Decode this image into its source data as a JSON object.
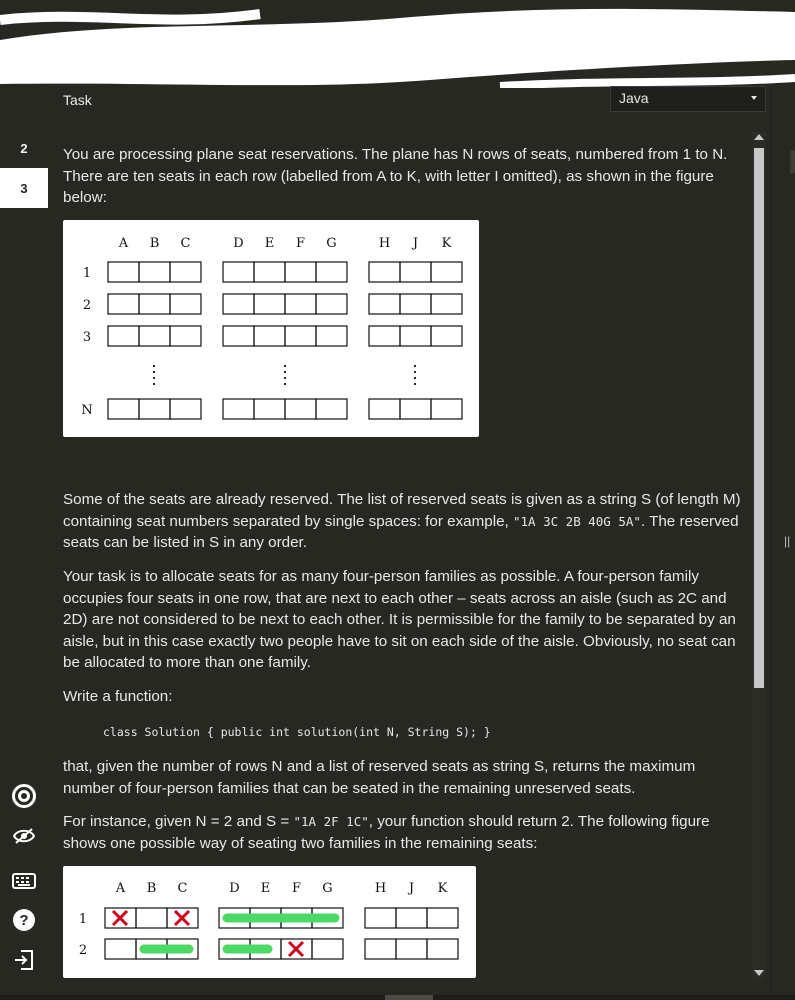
{
  "tabs": [
    "2",
    "3"
  ],
  "header": {
    "task_label": "Task",
    "language": "Java"
  },
  "task": {
    "p1": "You are processing plane seat reservations. The plane has N rows of seats, numbered from 1 to N. There are ten seats in each row (labelled from A to K, with letter I omitted), as shown in the figure below:",
    "p2_pre": "Some of the seats are already reserved. The list of reserved seats is given as a string S (of length M) containing seat numbers separated by single spaces: for example, ",
    "p2_code": "\"1A 3C 2B 40G 5A\"",
    "p2_post": ". The reserved seats can be listed in S in any order.",
    "p3": "Your task is to allocate seats for as many four-person families as possible. A four-person family occupies four seats in one row, that are next to each other – seats across an aisle (such as 2C and 2D) are not considered to be next to each other. It is permissible for the family to be separated by an aisle, but in this case exactly two people have to sit on each side of the aisle. Obviously, no seat can be allocated to more than one family.",
    "p4": "Write a function:",
    "signature": "class Solution { public int solution(int N, String S); }",
    "p5": "that, given the number of rows N and a list of reserved seats as string S, returns the maximum number of four-person families that can be seated in the remaining unreserved seats.",
    "p6_pre": "For instance, given N = 2 and S = ",
    "p6_code": "\"1A 2F 1C\"",
    "p6_post": ", your function should return 2. The following figure shows one possible way of seating two families in the remaining seats:"
  },
  "figure1": {
    "columns": [
      "A",
      "B",
      "C",
      "D",
      "E",
      "F",
      "G",
      "H",
      "J",
      "K"
    ],
    "rows": [
      "1",
      "2",
      "3",
      "N"
    ]
  },
  "figure2": {
    "columns": [
      "A",
      "B",
      "C",
      "D",
      "E",
      "F",
      "G",
      "H",
      "J",
      "K"
    ],
    "rows": [
      "1",
      "2"
    ]
  },
  "icons": [
    "settings-icon",
    "eye-slash-icon",
    "keyboard-icon",
    "help-icon",
    "exit-icon"
  ],
  "colors": {
    "background": "#272822",
    "reserved_mark": "#d0021b",
    "family_mark": "#4cd964"
  },
  "split_handle": "||"
}
